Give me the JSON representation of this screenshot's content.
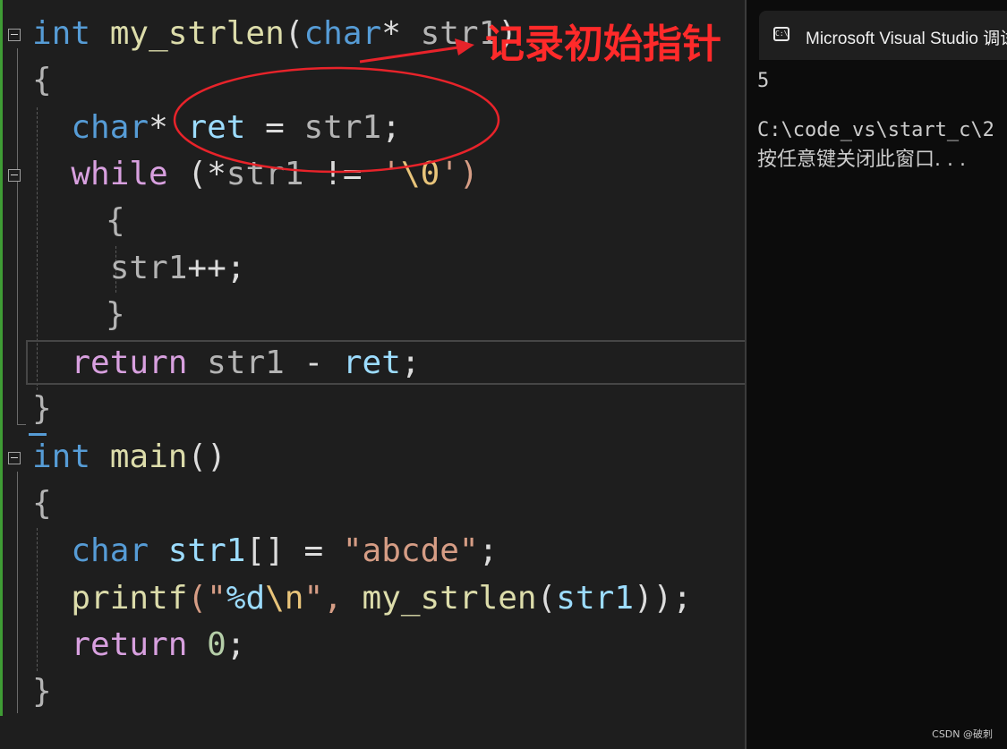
{
  "editor": {
    "line1": [
      "int",
      "my_strlen",
      "(",
      "char",
      "*",
      "str1",
      ")"
    ],
    "line2": "{",
    "line3": [
      "char",
      "*",
      "ret",
      "=",
      "str1",
      ";"
    ],
    "line4": [
      "while",
      "(*",
      "str1",
      "!=",
      "'",
      "\\0",
      "')"
    ],
    "line5": "{",
    "line6": [
      "str1",
      "++;"
    ],
    "line7": "}",
    "line8": [
      "return",
      "str1",
      "-",
      "ret",
      ";"
    ],
    "line9": "}",
    "line10": [
      "int",
      "main",
      "()"
    ],
    "line11": "{",
    "line12": [
      "char",
      "str1",
      "[]",
      "=",
      "\"abcde\"",
      ";"
    ],
    "line13": [
      "printf",
      "(\"",
      "%d",
      "\\n",
      "\",",
      "my_strlen",
      "(",
      "str1",
      "));"
    ],
    "line14": [
      "return",
      "0",
      ";"
    ],
    "line15": "}"
  },
  "annotation": {
    "text": "记录初始指针",
    "color": "#ff2a2a"
  },
  "console": {
    "tab_title": "Microsoft Visual Studio 调试",
    "icon": "terminal-icon",
    "output_value": "5",
    "path_line": "C:\\code_vs\\start_c\\2",
    "prompt_line": "按任意键关闭此窗口. . ."
  },
  "watermark": "CSDN @破刺",
  "colors": {
    "keyword": "#569cd6",
    "control": "#d8a0df",
    "function": "#dcdcaa",
    "variable": "#9cdcfe",
    "string": "#d69d85",
    "number": "#b5cea8",
    "background": "#1e1e1e"
  }
}
